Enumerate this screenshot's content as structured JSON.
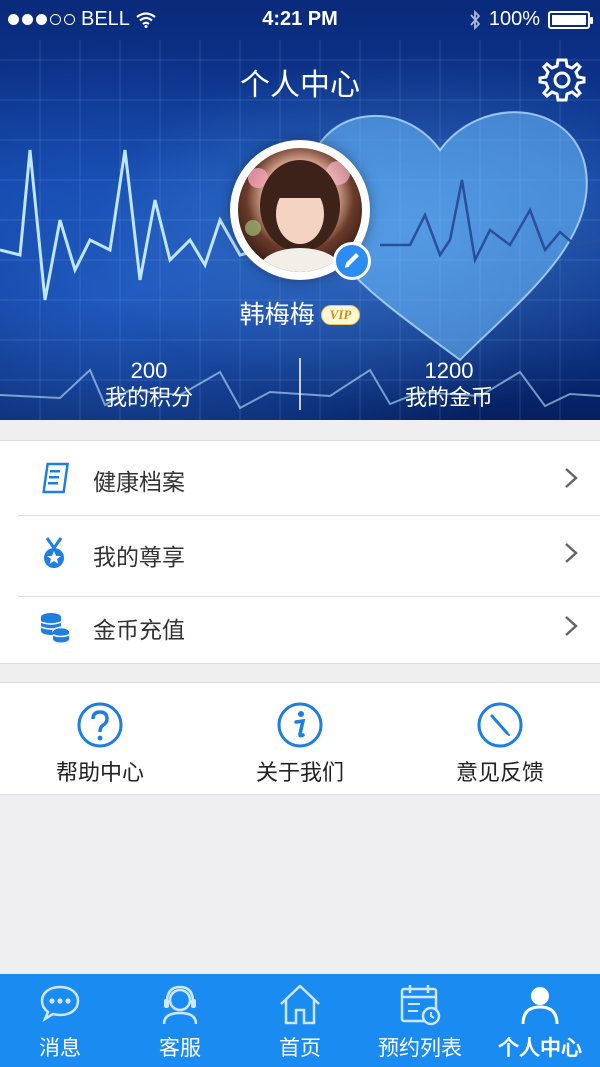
{
  "status_bar": {
    "carrier": "BELL",
    "time": "4:21 PM",
    "battery": "100%",
    "signal_bars_filled": 3,
    "signal_bars_total": 5
  },
  "header": {
    "title": "个人中心",
    "settings_icon": "gear-icon"
  },
  "profile": {
    "name": "韩梅梅",
    "badge": "VIP",
    "edit_icon": "pencil-icon",
    "points_value": "200",
    "points_label": "我的积分",
    "coins_value": "1200",
    "coins_label": "我的金币"
  },
  "menu": [
    {
      "label": "健康档案",
      "icon": "document-icon"
    },
    {
      "label": "我的尊享",
      "icon": "medal-icon"
    },
    {
      "label": "金币充值",
      "icon": "coins-icon"
    }
  ],
  "shortcuts": [
    {
      "label": "帮助中心",
      "icon": "question-icon"
    },
    {
      "label": "关于我们",
      "icon": "info-icon"
    },
    {
      "label": "意见反馈",
      "icon": "feedback-icon"
    }
  ],
  "tabs": [
    {
      "label": "消息",
      "icon": "chat-bubble-icon"
    },
    {
      "label": "客服",
      "icon": "headset-icon"
    },
    {
      "label": "首页",
      "icon": "home-icon"
    },
    {
      "label": "预约列表",
      "icon": "calendar-icon"
    },
    {
      "label": "个人中心",
      "icon": "person-icon"
    }
  ],
  "colors": {
    "accent": "#1a8bf0",
    "header_dark": "#0a2a7a",
    "icon_blue": "#1f7fe0"
  }
}
